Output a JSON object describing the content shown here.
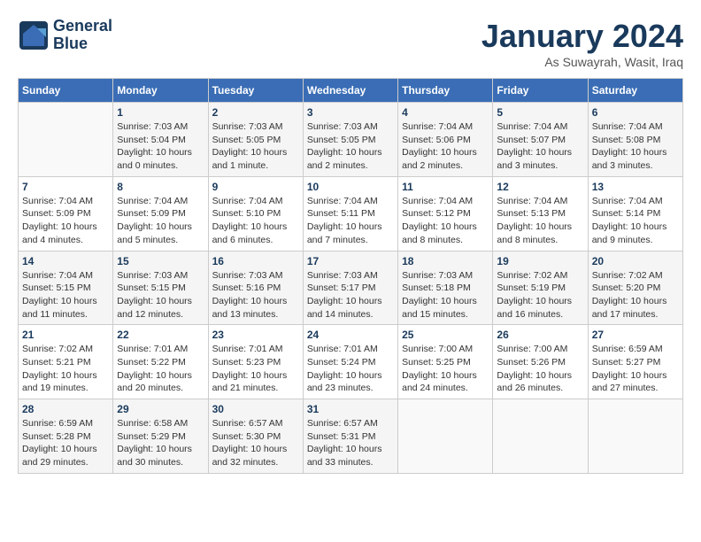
{
  "logo": {
    "text_line1": "General",
    "text_line2": "Blue"
  },
  "title": "January 2024",
  "subtitle": "As Suwayrah, Wasit, Iraq",
  "headers": [
    "Sunday",
    "Monday",
    "Tuesday",
    "Wednesday",
    "Thursday",
    "Friday",
    "Saturday"
  ],
  "weeks": [
    [
      {
        "day": "",
        "sunrise": "",
        "sunset": "",
        "daylight": ""
      },
      {
        "day": "1",
        "sunrise": "Sunrise: 7:03 AM",
        "sunset": "Sunset: 5:04 PM",
        "daylight": "Daylight: 10 hours and 0 minutes."
      },
      {
        "day": "2",
        "sunrise": "Sunrise: 7:03 AM",
        "sunset": "Sunset: 5:05 PM",
        "daylight": "Daylight: 10 hours and 1 minute."
      },
      {
        "day": "3",
        "sunrise": "Sunrise: 7:03 AM",
        "sunset": "Sunset: 5:05 PM",
        "daylight": "Daylight: 10 hours and 2 minutes."
      },
      {
        "day": "4",
        "sunrise": "Sunrise: 7:04 AM",
        "sunset": "Sunset: 5:06 PM",
        "daylight": "Daylight: 10 hours and 2 minutes."
      },
      {
        "day": "5",
        "sunrise": "Sunrise: 7:04 AM",
        "sunset": "Sunset: 5:07 PM",
        "daylight": "Daylight: 10 hours and 3 minutes."
      },
      {
        "day": "6",
        "sunrise": "Sunrise: 7:04 AM",
        "sunset": "Sunset: 5:08 PM",
        "daylight": "Daylight: 10 hours and 3 minutes."
      }
    ],
    [
      {
        "day": "7",
        "sunrise": "Sunrise: 7:04 AM",
        "sunset": "Sunset: 5:09 PM",
        "daylight": "Daylight: 10 hours and 4 minutes."
      },
      {
        "day": "8",
        "sunrise": "Sunrise: 7:04 AM",
        "sunset": "Sunset: 5:09 PM",
        "daylight": "Daylight: 10 hours and 5 minutes."
      },
      {
        "day": "9",
        "sunrise": "Sunrise: 7:04 AM",
        "sunset": "Sunset: 5:10 PM",
        "daylight": "Daylight: 10 hours and 6 minutes."
      },
      {
        "day": "10",
        "sunrise": "Sunrise: 7:04 AM",
        "sunset": "Sunset: 5:11 PM",
        "daylight": "Daylight: 10 hours and 7 minutes."
      },
      {
        "day": "11",
        "sunrise": "Sunrise: 7:04 AM",
        "sunset": "Sunset: 5:12 PM",
        "daylight": "Daylight: 10 hours and 8 minutes."
      },
      {
        "day": "12",
        "sunrise": "Sunrise: 7:04 AM",
        "sunset": "Sunset: 5:13 PM",
        "daylight": "Daylight: 10 hours and 8 minutes."
      },
      {
        "day": "13",
        "sunrise": "Sunrise: 7:04 AM",
        "sunset": "Sunset: 5:14 PM",
        "daylight": "Daylight: 10 hours and 9 minutes."
      }
    ],
    [
      {
        "day": "14",
        "sunrise": "Sunrise: 7:04 AM",
        "sunset": "Sunset: 5:15 PM",
        "daylight": "Daylight: 10 hours and 11 minutes."
      },
      {
        "day": "15",
        "sunrise": "Sunrise: 7:03 AM",
        "sunset": "Sunset: 5:15 PM",
        "daylight": "Daylight: 10 hours and 12 minutes."
      },
      {
        "day": "16",
        "sunrise": "Sunrise: 7:03 AM",
        "sunset": "Sunset: 5:16 PM",
        "daylight": "Daylight: 10 hours and 13 minutes."
      },
      {
        "day": "17",
        "sunrise": "Sunrise: 7:03 AM",
        "sunset": "Sunset: 5:17 PM",
        "daylight": "Daylight: 10 hours and 14 minutes."
      },
      {
        "day": "18",
        "sunrise": "Sunrise: 7:03 AM",
        "sunset": "Sunset: 5:18 PM",
        "daylight": "Daylight: 10 hours and 15 minutes."
      },
      {
        "day": "19",
        "sunrise": "Sunrise: 7:02 AM",
        "sunset": "Sunset: 5:19 PM",
        "daylight": "Daylight: 10 hours and 16 minutes."
      },
      {
        "day": "20",
        "sunrise": "Sunrise: 7:02 AM",
        "sunset": "Sunset: 5:20 PM",
        "daylight": "Daylight: 10 hours and 17 minutes."
      }
    ],
    [
      {
        "day": "21",
        "sunrise": "Sunrise: 7:02 AM",
        "sunset": "Sunset: 5:21 PM",
        "daylight": "Daylight: 10 hours and 19 minutes."
      },
      {
        "day": "22",
        "sunrise": "Sunrise: 7:01 AM",
        "sunset": "Sunset: 5:22 PM",
        "daylight": "Daylight: 10 hours and 20 minutes."
      },
      {
        "day": "23",
        "sunrise": "Sunrise: 7:01 AM",
        "sunset": "Sunset: 5:23 PM",
        "daylight": "Daylight: 10 hours and 21 minutes."
      },
      {
        "day": "24",
        "sunrise": "Sunrise: 7:01 AM",
        "sunset": "Sunset: 5:24 PM",
        "daylight": "Daylight: 10 hours and 23 minutes."
      },
      {
        "day": "25",
        "sunrise": "Sunrise: 7:00 AM",
        "sunset": "Sunset: 5:25 PM",
        "daylight": "Daylight: 10 hours and 24 minutes."
      },
      {
        "day": "26",
        "sunrise": "Sunrise: 7:00 AM",
        "sunset": "Sunset: 5:26 PM",
        "daylight": "Daylight: 10 hours and 26 minutes."
      },
      {
        "day": "27",
        "sunrise": "Sunrise: 6:59 AM",
        "sunset": "Sunset: 5:27 PM",
        "daylight": "Daylight: 10 hours and 27 minutes."
      }
    ],
    [
      {
        "day": "28",
        "sunrise": "Sunrise: 6:59 AM",
        "sunset": "Sunset: 5:28 PM",
        "daylight": "Daylight: 10 hours and 29 minutes."
      },
      {
        "day": "29",
        "sunrise": "Sunrise: 6:58 AM",
        "sunset": "Sunset: 5:29 PM",
        "daylight": "Daylight: 10 hours and 30 minutes."
      },
      {
        "day": "30",
        "sunrise": "Sunrise: 6:57 AM",
        "sunset": "Sunset: 5:30 PM",
        "daylight": "Daylight: 10 hours and 32 minutes."
      },
      {
        "day": "31",
        "sunrise": "Sunrise: 6:57 AM",
        "sunset": "Sunset: 5:31 PM",
        "daylight": "Daylight: 10 hours and 33 minutes."
      },
      {
        "day": "",
        "sunrise": "",
        "sunset": "",
        "daylight": ""
      },
      {
        "day": "",
        "sunrise": "",
        "sunset": "",
        "daylight": ""
      },
      {
        "day": "",
        "sunrise": "",
        "sunset": "",
        "daylight": ""
      }
    ]
  ]
}
